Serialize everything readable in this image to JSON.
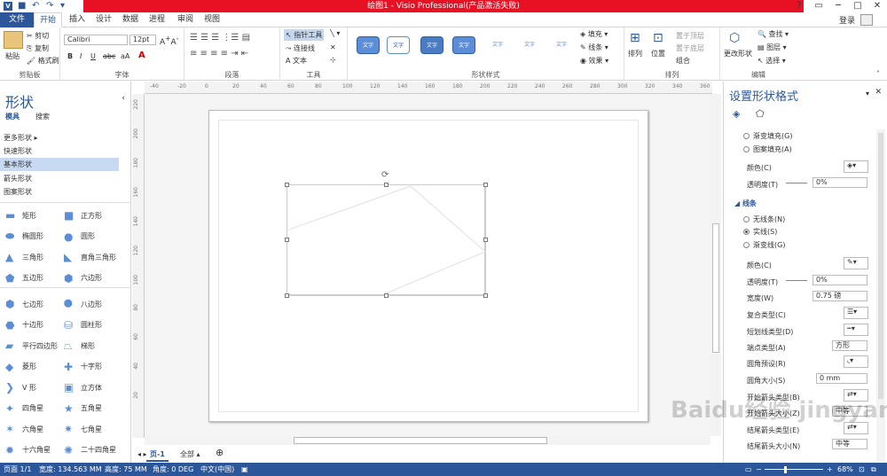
{
  "window": {
    "title": "绘图1 - Visio Professional(产品激活失败)",
    "help": "?",
    "login": "登录"
  },
  "tabs": [
    "文件",
    "开始",
    "插入",
    "设计",
    "数据",
    "进程",
    "审阅",
    "视图"
  ],
  "ribbon": {
    "clipboard": {
      "paste": "粘贴",
      "cut": "剪切",
      "copy": "复制",
      "format_painter": "格式刷",
      "label": "剪贴板"
    },
    "font": {
      "family": "Calibri",
      "size": "12pt",
      "label": "字体",
      "bold": "B",
      "italic": "I",
      "underline": "U",
      "strike": "abc",
      "aa": "aA",
      "font_color": "A"
    },
    "paragraph": {
      "label": "段落"
    },
    "tools": {
      "pointer": "指针工具",
      "connector": "连接线",
      "text": "文本",
      "label": "工具"
    },
    "shape_styles": {
      "tiles": [
        "文字",
        "文字",
        "文字",
        "文字",
        "文字",
        "文字",
        "文字"
      ],
      "label": "形状样式",
      "fill": "填充",
      "line": "线条",
      "effects": "效果"
    },
    "arrange": {
      "align": "排列",
      "position": "位置",
      "bring_front": "置于顶层",
      "send_back": "置于底层",
      "group": "组合",
      "label": "排列"
    },
    "editing": {
      "change_shape": "更改形状",
      "find": "查找",
      "layers": "图层",
      "select": "选择",
      "label": "编辑"
    }
  },
  "shapes_panel": {
    "title": "形状",
    "tabs": [
      "模具",
      "搜索"
    ],
    "more_shapes": "更多形状",
    "stencils": [
      "快速形状",
      "基本形状",
      "箭头形状",
      "图案形状"
    ],
    "selected_stencil": "基本形状",
    "items": [
      [
        "矩形",
        "正方形"
      ],
      [
        "椭圆形",
        "圆形"
      ],
      [
        "三角形",
        "直角三角形"
      ],
      [
        "五边形",
        "六边形"
      ],
      [
        "七边形",
        "八边形"
      ],
      [
        "十边形",
        "圆柱形"
      ],
      [
        "平行四边形",
        "梯形"
      ],
      [
        "菱形",
        "十字形"
      ],
      [
        "V 形",
        "立方体"
      ],
      [
        "四角星",
        "五角星"
      ],
      [
        "六角星",
        "七角星"
      ],
      [
        "十六角星",
        "二十四角星"
      ]
    ]
  },
  "ruler": {
    "h": [
      "-40",
      "-20",
      "0",
      "20",
      "40",
      "60",
      "80",
      "100",
      "120",
      "140",
      "160",
      "180",
      "200",
      "220",
      "240",
      "260",
      "280",
      "300",
      "320",
      "340",
      "360"
    ],
    "v": [
      "220",
      "200",
      "180",
      "160",
      "140",
      "120",
      "100",
      "80",
      "60",
      "40",
      "20"
    ]
  },
  "page_tabs": {
    "current": "页-1",
    "all": "全部",
    "add": "⊕"
  },
  "format_panel": {
    "title": "设置形状格式",
    "fill_options": [
      "渐变填充(G)",
      "图案填充(A)"
    ],
    "color_label": "颜色(C)",
    "transparency_label": "透明度(T)",
    "transparency_value": "0%",
    "line_section": "线条",
    "line_options": [
      "无线条(N)",
      "实线(S)",
      "渐变线(G)"
    ],
    "selected_line": "实线(S)",
    "line_color_label": "颜色(C)",
    "line_transparency_label": "透明度(T)",
    "line_transparency_value": "0%",
    "width_label": "宽度(W)",
    "width_value": "0.75 磅",
    "compound_label": "复合类型(C)",
    "dash_label": "短划线类型(D)",
    "cap_label": "端点类型(A)",
    "cap_value": "方形",
    "corner_preset_label": "圆角预设(R)",
    "corner_size_label": "圆角大小(S)",
    "corner_size_value": "0 mm",
    "arrow_begin_type_label": "开始箭头类型(B)",
    "arrow_begin_size_label": "开始箭头大小(Z)",
    "arrow_begin_size_value": "中等",
    "arrow_end_type_label": "结尾箭头类型(E)",
    "arrow_end_size_label": "结尾箭头大小(N)",
    "arrow_end_size_value": "中等"
  },
  "status": {
    "page": "页面 1/1",
    "width": "宽度: 134.563 MM",
    "height": "高度: 75 MM",
    "angle": "角度: 0 DEG",
    "lang": "中文(中国)",
    "zoom": "68%"
  },
  "watermark": "Baidu经验 jingyan.baidu.com",
  "colors": {
    "accent": "#2b579a",
    "title_red": "#e81123",
    "shape_blue": "#5b8ed6"
  }
}
